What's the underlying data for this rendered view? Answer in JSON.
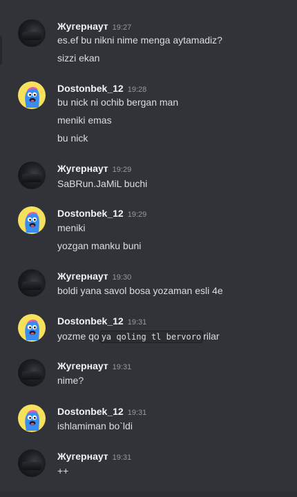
{
  "messages": [
    {
      "author": "Жугернаут",
      "time": "19:27",
      "avatar": "dark-avatar",
      "lines": [
        "es.ef bu nikni nime menga aytamadiz?",
        "sizzi ekan"
      ]
    },
    {
      "author": "Dostonbek_12",
      "time": "19:28",
      "avatar": "blue-blob-avatar",
      "lines": [
        "bu nick ni ochib bergan man",
        "meniki emas",
        "bu nick"
      ]
    },
    {
      "author": "Жугернаут",
      "time": "19:29",
      "avatar": "dark-avatar",
      "lines": [
        "SaBRun.JaMiL buchi"
      ]
    },
    {
      "author": "Dostonbek_12",
      "time": "19:29",
      "avatar": "blue-blob-avatar",
      "lines": [
        "meniki",
        "yozgan manku buni"
      ]
    },
    {
      "author": "Жугернаут",
      "time": "19:30",
      "avatar": "dark-avatar",
      "lines": [
        "boldi yana savol bosa yozaman esli 4e"
      ]
    },
    {
      "author": "Dostonbek_12",
      "time": "19:31",
      "avatar": "blue-blob-avatar",
      "rich": {
        "before": "yozme qo",
        "code": "ya qoling tl bervoro",
        "after": "rilar"
      }
    },
    {
      "author": "Жугернаут",
      "time": "19:31",
      "avatar": "dark-avatar",
      "lines": [
        "nime?"
      ]
    },
    {
      "author": "Dostonbek_12",
      "time": "19:31",
      "avatar": "blue-blob-avatar",
      "lines": [
        "ishlamiman bo`ldi"
      ]
    },
    {
      "author": "Жугернаут",
      "time": "19:31",
      "avatar": "dark-avatar",
      "lines": [
        "++"
      ]
    }
  ]
}
